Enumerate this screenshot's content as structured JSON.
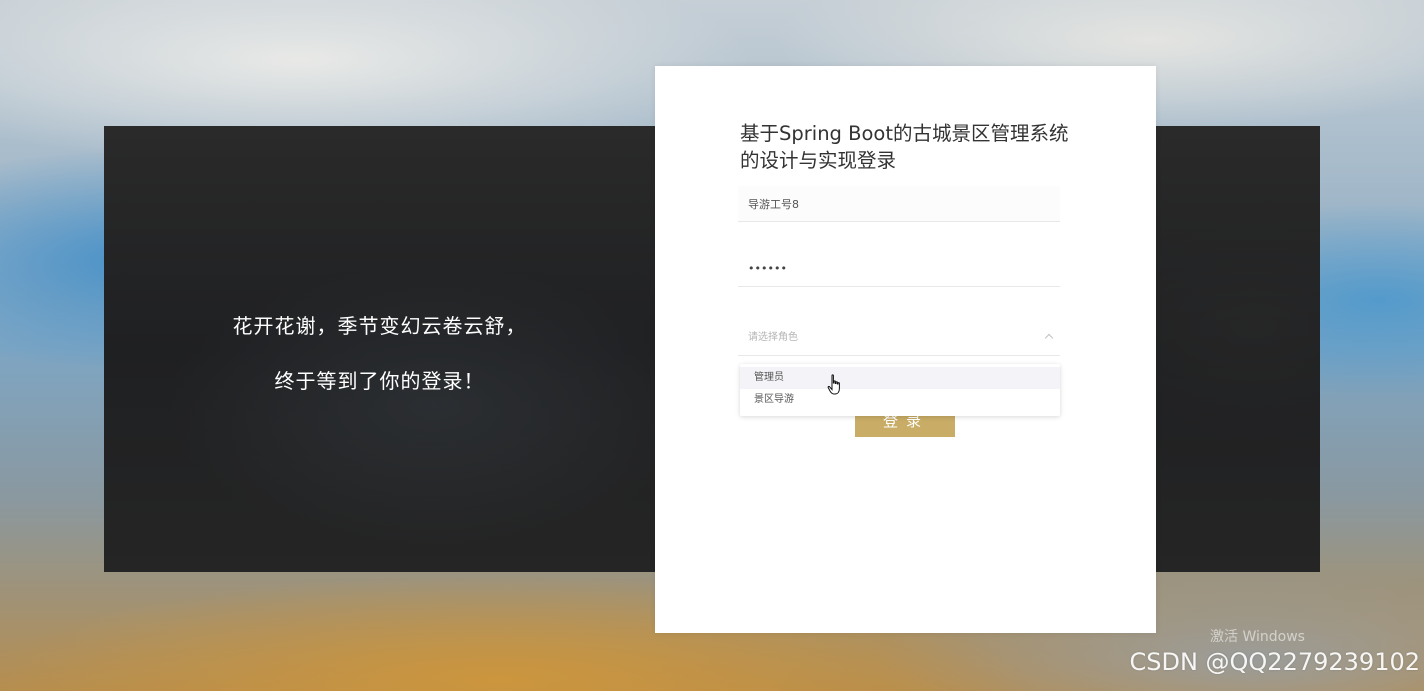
{
  "slogan": {
    "line1": "花开花谢，季节变幻云卷云舒，",
    "line2": "终于等到了你的登录！"
  },
  "login": {
    "title": "基于Spring Boot的古城景区管理系统的设计与实现登录",
    "username_value": "导游工号8",
    "password_value": "••••••",
    "role_placeholder": "请选择角色",
    "role_options": [
      "管理员",
      "景区导游"
    ],
    "submit_label": "登录"
  },
  "watermarks": {
    "windows": "激活 Windows",
    "csdn": "CSDN @QQ2279239102"
  },
  "colors": {
    "button": "#c9ad66",
    "panel": "#222222",
    "card": "#ffffff"
  }
}
